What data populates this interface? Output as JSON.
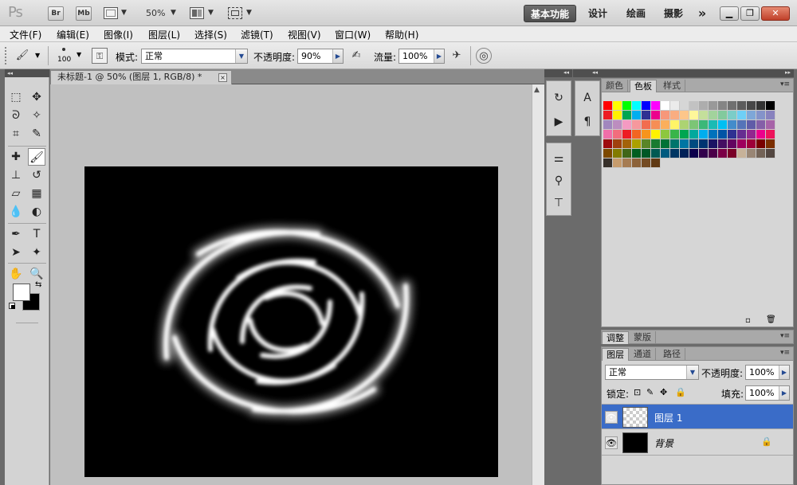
{
  "titlebar": {
    "logo": "Ps",
    "bridge": "Br",
    "minibridge": "Mb",
    "zoom": "50%",
    "workspaces": [
      "基本功能",
      "设计",
      "绘画",
      "摄影"
    ],
    "more": "»"
  },
  "menu": [
    "文件(F)",
    "编辑(E)",
    "图像(I)",
    "图层(L)",
    "选择(S)",
    "滤镜(T)",
    "视图(V)",
    "窗口(W)",
    "帮助(H)"
  ],
  "options": {
    "brush_size": "100",
    "mode_label": "模式:",
    "mode_value": "正常",
    "opacity_label": "不透明度:",
    "opacity_value": "90%",
    "flow_label": "流量:",
    "flow_value": "100%"
  },
  "document": {
    "tab_title": "未标题-1 @ 50% (图层 1, RGB/8) *",
    "close": "×",
    "image_desc": "white-swirl-on-black"
  },
  "panels": {
    "color_tabs": [
      "颜色",
      "色板",
      "样式"
    ],
    "color_active": "色板",
    "adjust_tabs": [
      "调整",
      "蒙版"
    ],
    "adjust_active": "调整",
    "layer_tabs": [
      "图层",
      "通道",
      "路径"
    ],
    "layer_active": "图层",
    "blend_mode": "正常",
    "opacity_label": "不透明度:",
    "opacity_value": "100%",
    "lock_label": "锁定:",
    "fill_label": "填充:",
    "fill_value": "100%",
    "layers": [
      {
        "name": "图层 1",
        "selected": true
      },
      {
        "name": "背景",
        "selected": false
      }
    ]
  },
  "colors": {
    "accent": "#3a6cc8",
    "canvas": "#000000",
    "workspace_bg": "#c0c0c0",
    "chrome": "#d3d3d3",
    "close_button": "#c0402a"
  },
  "icons": {
    "brush": "brush-icon",
    "move": "move-icon",
    "marquee": "marquee-icon",
    "lasso": "lasso-icon",
    "crop": "crop-icon",
    "eyedropper": "eyedropper-icon",
    "hand": "hand-icon",
    "zoom": "zoom-icon",
    "eye": "eye-icon",
    "lock": "lock-icon"
  }
}
